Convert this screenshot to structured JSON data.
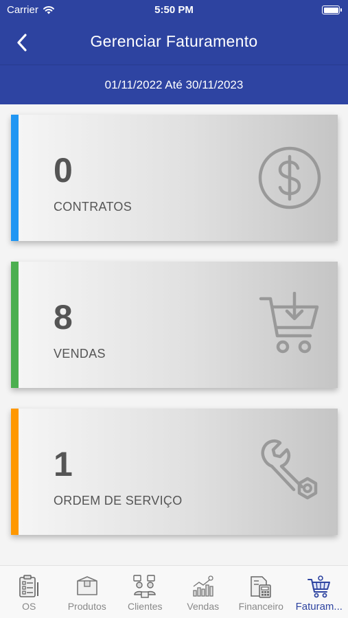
{
  "status_bar": {
    "carrier": "Carrier",
    "time": "5:50 PM"
  },
  "header": {
    "title": "Gerenciar Faturamento",
    "back_icon": "chevron-left-icon"
  },
  "date_range": "01/11/2022 Até 30/11/2023",
  "cards": [
    {
      "value": "0",
      "label": "CONTRATOS",
      "accent": "#2196f3",
      "icon": "dollar-circle-icon"
    },
    {
      "value": "8",
      "label": "VENDAS",
      "accent": "#4caf50",
      "icon": "cart-download-icon"
    },
    {
      "value": "1",
      "label": "ORDEM DE SERVIÇO",
      "accent": "#ff9800",
      "icon": "wrench-icon"
    }
  ],
  "tabs": [
    {
      "label": "OS",
      "icon": "clipboard-icon",
      "active": false
    },
    {
      "label": "Produtos",
      "icon": "box-icon",
      "active": false
    },
    {
      "label": "Clientes",
      "icon": "clients-icon",
      "active": false
    },
    {
      "label": "Vendas",
      "icon": "sales-chart-icon",
      "active": false
    },
    {
      "label": "Financeiro",
      "icon": "calculator-icon",
      "active": false
    },
    {
      "label": "Faturam...",
      "icon": "cart-icon",
      "active": true
    }
  ],
  "colors": {
    "primary": "#2d43a0",
    "tab_inactive": "#888888",
    "card_text": "#555555"
  }
}
